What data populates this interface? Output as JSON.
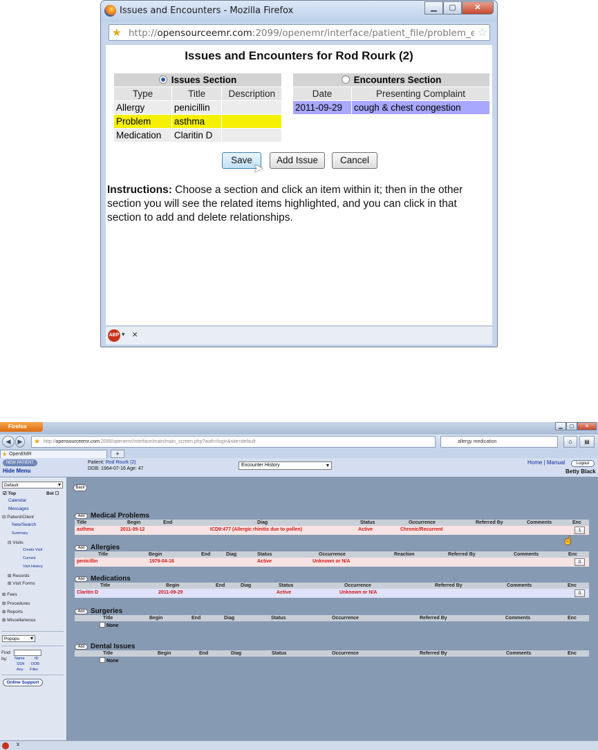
{
  "popup": {
    "window_title": "Issues and Encounters - Mozilla Firefox",
    "url_prefix": "http://",
    "url_host": "opensourceemr.com",
    "url_path": ":2099/openemr/interface/patient_file/problem_encounter.php?i",
    "heading": "Issues and Encounters for Rod Rourk (2)",
    "issues_section": {
      "label": "Issues Section",
      "selected": true,
      "columns": [
        "Type",
        "Title",
        "Description"
      ],
      "rows": [
        {
          "type": "Allergy",
          "title": "penicillin",
          "description": "",
          "highlight": false
        },
        {
          "type": "Problem",
          "title": "asthma",
          "description": "",
          "highlight": true
        },
        {
          "type": "Medication",
          "title": "Claritin D",
          "description": "",
          "highlight": false
        }
      ]
    },
    "encounters_section": {
      "label": "Encounters Section",
      "selected": false,
      "columns": [
        "Date",
        "Presenting Complaint"
      ],
      "rows": [
        {
          "date": "2011-09-29",
          "complaint": "cough & chest congestion",
          "highlight": true
        }
      ]
    },
    "buttons": {
      "save": "Save",
      "add_issue": "Add Issue",
      "cancel": "Cancel"
    },
    "instructions_label": "Instructions:",
    "instructions_text": " Choose a section and click an item within it; then in the other section you will see the related items highlighted, and you can click in that section to add and delete relationships.",
    "highlight_yellow": "#f5f000",
    "highlight_blue": "#a8a8ff"
  },
  "main": {
    "firefox_button": "Firefox",
    "url_prefix": "http://",
    "url_host": "opensourceemr.com",
    "url_path": ":2099/openemr/interface/main/main_screen.php?auth=login&site=default",
    "search_text": "allergy medication",
    "tab_label": "OpenEMR",
    "new_tab": "+",
    "new_patient": "NEW PATIENT",
    "hide_menu": "Hide Menu",
    "patient_label": "Patient:",
    "patient_name": "Rod Rourk (2)",
    "dob_line": "DOB: 1964-07-16 Age: 47",
    "encounter_history": "Encounter History",
    "home": "Home",
    "sep": "|",
    "manual": "Manual",
    "logout": "Logout",
    "user": "Betty Black",
    "sidebar": {
      "default_select": "Default",
      "top": "Top",
      "bot": "Bot",
      "items": [
        "Calendar",
        "Messages",
        "Patient/Client",
        "New/Search",
        "Summary",
        "Visits",
        "Create Visit",
        "Current",
        "Visit History",
        "Records",
        "Visit Forms",
        "Fees",
        "Procedures",
        "Reports",
        "Miscellaneous"
      ],
      "popups": "Popups",
      "find": "Find:",
      "by": "by:",
      "by_options": [
        "Name",
        "ID",
        "SSN",
        "DOB",
        "Any",
        "Filter"
      ],
      "online_support": "Online Support"
    },
    "back": "Back",
    "add": "Add",
    "sections": {
      "medical_problems": {
        "title": "Medical Problems",
        "columns": [
          "Title",
          "Begin",
          "End",
          "Diag",
          "Status",
          "Occurrence",
          "Referred By",
          "Comments",
          "Enc"
        ],
        "row": {
          "title": "asthma",
          "begin": "2011-09-12",
          "end": "",
          "diag": "ICD9:477 (Allergic rhinitis due to pollen)",
          "status": "Active",
          "occurrence": "Chronic/Recurrent",
          "enc": "1"
        }
      },
      "allergies": {
        "title": "Allergies",
        "columns": [
          "Title",
          "Begin",
          "End",
          "Diag",
          "Status",
          "Occurrence",
          "Reaction",
          "Referred By",
          "Comments",
          "Enc"
        ],
        "row": {
          "title": "penicillin",
          "begin": "1979-04-16",
          "status": "Active",
          "occurrence": "Unknown or N/A",
          "enc": "0"
        }
      },
      "medications": {
        "title": "Medications",
        "columns": [
          "Title",
          "Begin",
          "End",
          "Diag",
          "Status",
          "Occurrence",
          "Referred By",
          "Comments",
          "Enc"
        ],
        "row": {
          "title": "Claritin D",
          "begin": "2011-09-29",
          "status": "Active",
          "occurrence": "Unknown or N/A",
          "enc": "0"
        }
      },
      "surgeries": {
        "title": "Surgeries",
        "columns": [
          "Title",
          "Begin",
          "End",
          "Diag",
          "Status",
          "Occurrence",
          "Referred By",
          "Comments",
          "Enc"
        ],
        "none": "None"
      },
      "dental": {
        "title": "Dental Issues",
        "columns": [
          "Title",
          "Begin",
          "End",
          "Diag",
          "Status",
          "Occurrence",
          "Referred By",
          "Comments",
          "Enc"
        ],
        "none": "None"
      }
    },
    "status_x": "x"
  }
}
